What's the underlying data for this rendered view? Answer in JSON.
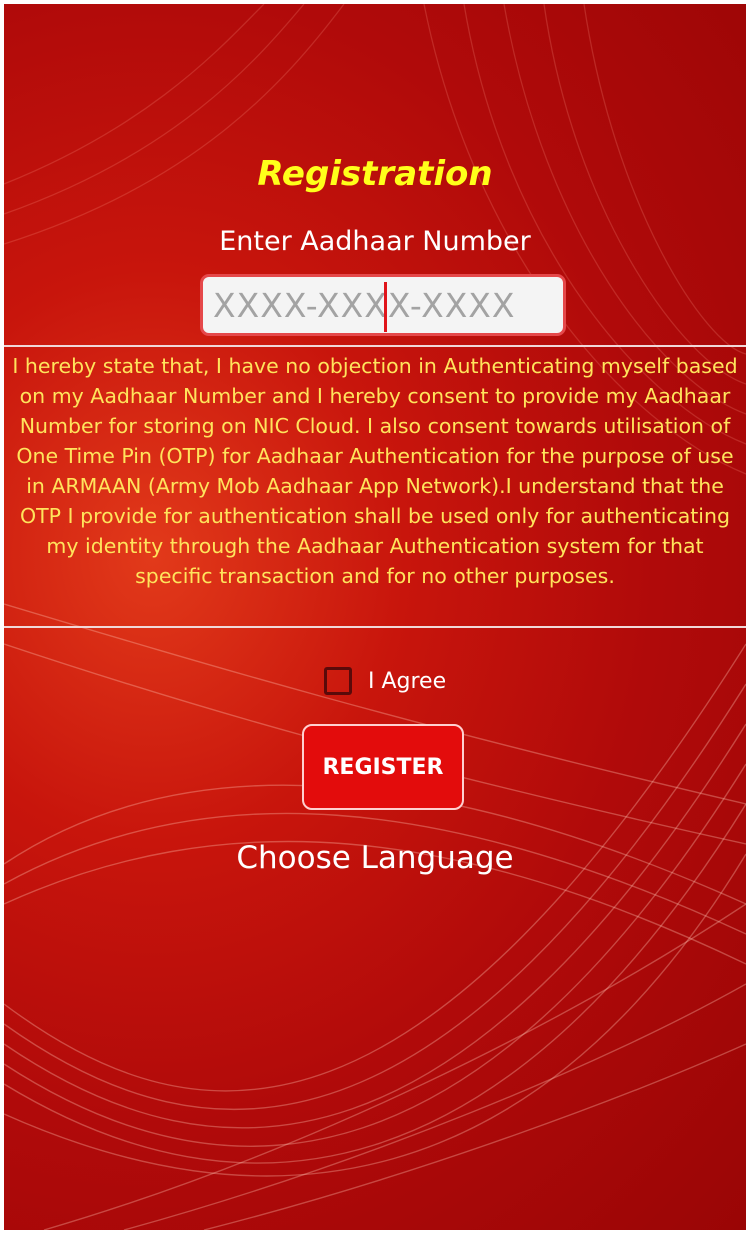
{
  "registration": {
    "title": "Registration",
    "aadhaar_label": "Enter Aadhaar Number",
    "aadhaar_placeholder": "XXXX-XXXX-XXXX",
    "aadhaar_value": "",
    "consent_text": "I hereby state that, I have no objection in Authenticating myself based on my Aadhaar Number and I hereby consent to provide my Aadhaar Number for storing on NIC Cloud. I also consent towards utilisation of One Time Pin (OTP) for Aadhaar Authentication for the purpose of use in ARMAAN (Army Mob Aadhaar App Network).I understand that the OTP I provide for authentication shall be used only for authenticating my identity through the Aadhaar Authentication system for that specific transaction and for no other purposes.",
    "agree_label": "I Agree",
    "agree_checked": false,
    "register_label": "REGISTER",
    "choose_language_label": "Choose Language"
  },
  "colors": {
    "title": "#ffff1a",
    "consent_text": "#ffe45c",
    "register_button": "#e30c0c",
    "background": "#b00a0a"
  }
}
